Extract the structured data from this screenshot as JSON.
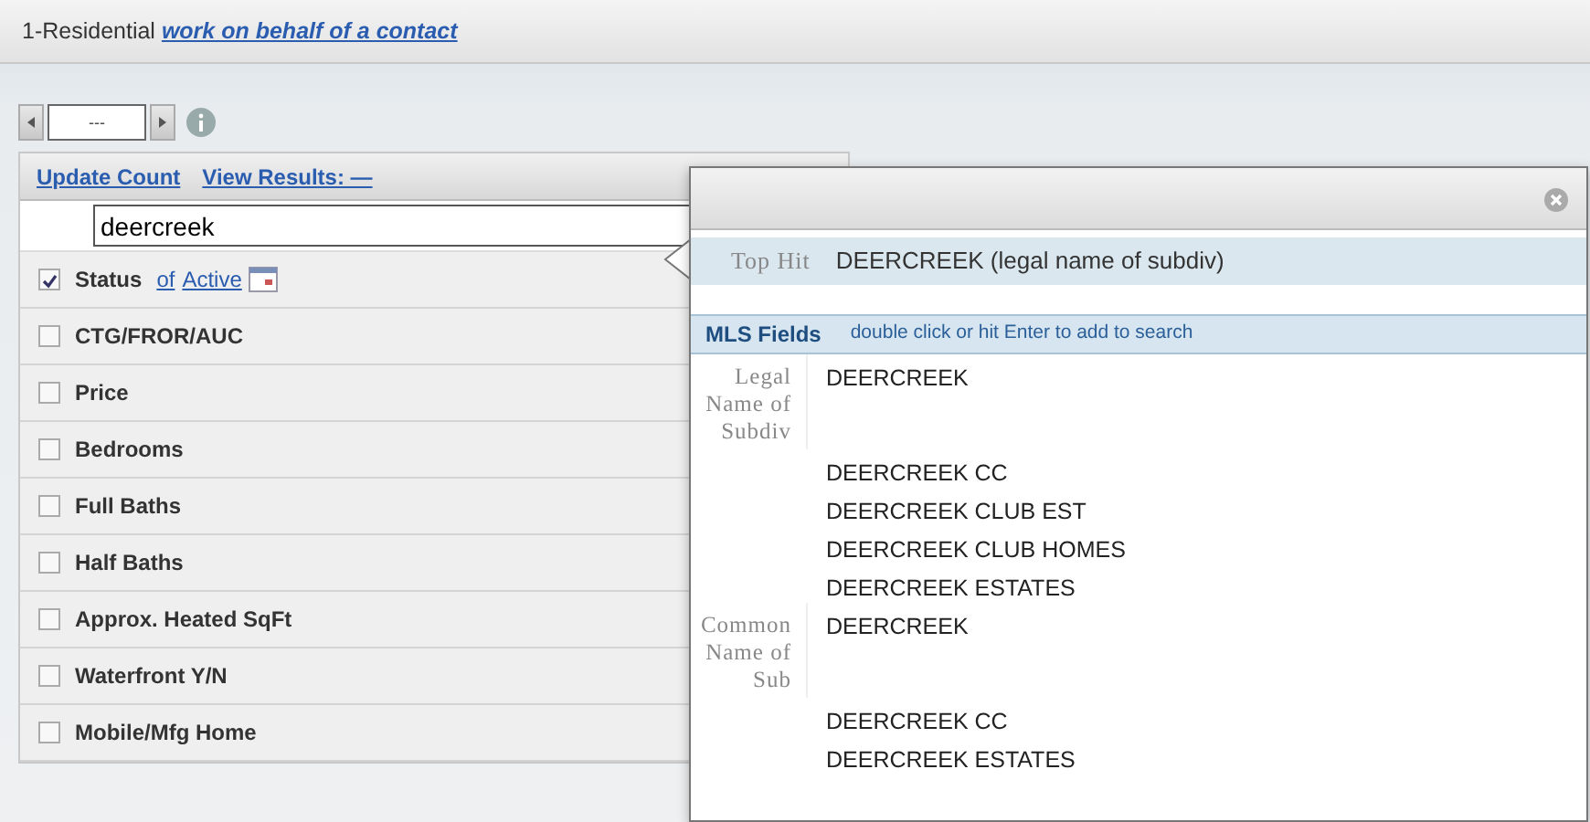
{
  "header": {
    "title": "1-Residential",
    "link": "work on behalf of a contact"
  },
  "pager": {
    "value": "---"
  },
  "panel": {
    "update_count": "Update Count",
    "view_results": "View Results: —",
    "search": {
      "value": "deercreek"
    },
    "criteria": [
      {
        "label": "Status",
        "checked": true,
        "connector": "of",
        "value": "Active"
      },
      {
        "label": "CTG/FROR/AUC",
        "checked": false
      },
      {
        "label": "Price",
        "checked": false
      },
      {
        "label": "Bedrooms",
        "checked": false
      },
      {
        "label": "Full Baths",
        "checked": false
      },
      {
        "label": "Half Baths",
        "checked": false
      },
      {
        "label": "Approx. Heated SqFt",
        "checked": false
      },
      {
        "label": "Waterfront Y/N",
        "checked": false
      },
      {
        "label": "Mobile/Mfg Home",
        "checked": false
      }
    ]
  },
  "popup": {
    "top_hit": {
      "label": "Top Hit",
      "value": "DEERCREEK  (legal name of subdiv)"
    },
    "mls_fields": {
      "title": "MLS Fields",
      "hint": "double click or hit Enter to add to search"
    },
    "groups": [
      {
        "label": "Legal Name of Subdiv",
        "values": [
          "DEERCREEK",
          "DEERCREEK CC",
          "DEERCREEK CLUB EST",
          "DEERCREEK CLUB HOMES",
          "DEERCREEK ESTATES"
        ]
      },
      {
        "label": "Common Name of Sub",
        "values": [
          "DEERCREEK",
          "DEERCREEK CC",
          "DEERCREEK ESTATES"
        ]
      }
    ]
  }
}
